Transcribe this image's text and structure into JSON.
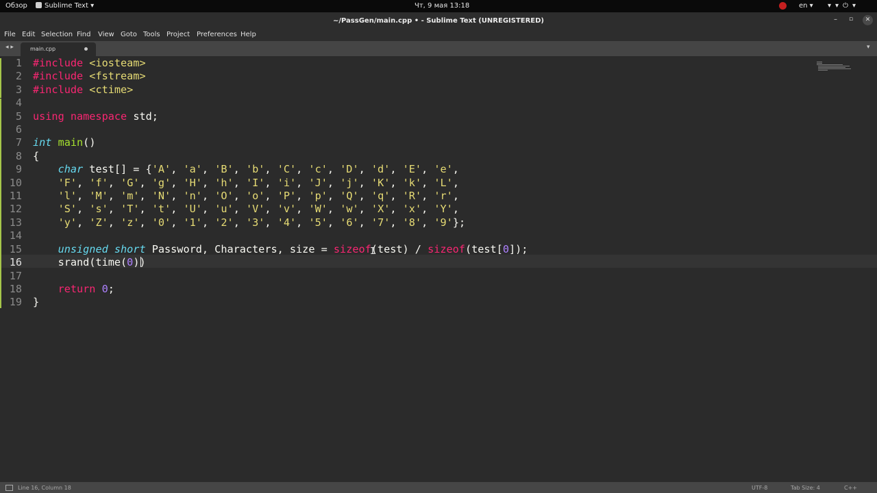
{
  "topbar": {
    "overview": "Обзор",
    "app_menu": "Sublime Text ▾",
    "clock": "Чт, 9 мая  13:18",
    "lang": "en ▾",
    "sys_icons": "▾▾⏻▾"
  },
  "window": {
    "title": "~/PassGen/main.cpp • - Sublime Text (UNREGISTERED)",
    "minimize": "–",
    "maximize": "▫",
    "close": "✕"
  },
  "menu": [
    "File",
    "Edit",
    "Selection",
    "Find",
    "View",
    "Goto",
    "Tools",
    "Project",
    "Preferences",
    "Help"
  ],
  "tabs": {
    "nav_arrows": "◂ ▸",
    "active_tab": "main.cpp",
    "dropdown": "▾"
  },
  "editor": {
    "current_line": 16,
    "line_numbers": [
      "1",
      "2",
      "3",
      "4",
      "5",
      "6",
      "7",
      "8",
      "9",
      "10",
      "11",
      "12",
      "13",
      "14",
      "15",
      "16",
      "17",
      "18",
      "19"
    ],
    "lines": [
      [
        [
          "pp",
          "#include "
        ],
        [
          "inc",
          "<iosteam>"
        ]
      ],
      [
        [
          "pp",
          "#include "
        ],
        [
          "inc",
          "<fstream>"
        ]
      ],
      [
        [
          "pp",
          "#include "
        ],
        [
          "inc",
          "<ctime>"
        ]
      ],
      [],
      [
        [
          "kw",
          "using namespace "
        ],
        [
          "pl",
          "std;"
        ]
      ],
      [],
      [
        [
          "type",
          "int"
        ],
        [
          "pl",
          " "
        ],
        [
          "fn",
          "main"
        ],
        [
          "pl",
          "()"
        ]
      ],
      [
        [
          "pl",
          "{"
        ]
      ],
      [
        [
          "pl",
          "    "
        ],
        [
          "type",
          "char"
        ],
        [
          "pl",
          " test[] = {"
        ],
        [
          "str",
          "'A'"
        ],
        [
          "pl",
          ", "
        ],
        [
          "str",
          "'a'"
        ],
        [
          "pl",
          ", "
        ],
        [
          "str",
          "'B'"
        ],
        [
          "pl",
          ", "
        ],
        [
          "str",
          "'b'"
        ],
        [
          "pl",
          ", "
        ],
        [
          "str",
          "'C'"
        ],
        [
          "pl",
          ", "
        ],
        [
          "str",
          "'c'"
        ],
        [
          "pl",
          ", "
        ],
        [
          "str",
          "'D'"
        ],
        [
          "pl",
          ", "
        ],
        [
          "str",
          "'d'"
        ],
        [
          "pl",
          ", "
        ],
        [
          "str",
          "'E'"
        ],
        [
          "pl",
          ", "
        ],
        [
          "str",
          "'e'"
        ],
        [
          "pl",
          ","
        ]
      ],
      [
        [
          "pl",
          "    "
        ],
        [
          "str",
          "'F'"
        ],
        [
          "pl",
          ", "
        ],
        [
          "str",
          "'f'"
        ],
        [
          "pl",
          ", "
        ],
        [
          "str",
          "'G'"
        ],
        [
          "pl",
          ", "
        ],
        [
          "str",
          "'g'"
        ],
        [
          "pl",
          ", "
        ],
        [
          "str",
          "'H'"
        ],
        [
          "pl",
          ", "
        ],
        [
          "str",
          "'h'"
        ],
        [
          "pl",
          ", "
        ],
        [
          "str",
          "'I'"
        ],
        [
          "pl",
          ", "
        ],
        [
          "str",
          "'i'"
        ],
        [
          "pl",
          ", "
        ],
        [
          "str",
          "'J'"
        ],
        [
          "pl",
          ", "
        ],
        [
          "str",
          "'j'"
        ],
        [
          "pl",
          ", "
        ],
        [
          "str",
          "'K'"
        ],
        [
          "pl",
          ", "
        ],
        [
          "str",
          "'k'"
        ],
        [
          "pl",
          ", "
        ],
        [
          "str",
          "'L'"
        ],
        [
          "pl",
          ","
        ]
      ],
      [
        [
          "pl",
          "    "
        ],
        [
          "str",
          "'l'"
        ],
        [
          "pl",
          ", "
        ],
        [
          "str",
          "'M'"
        ],
        [
          "pl",
          ", "
        ],
        [
          "str",
          "'m'"
        ],
        [
          "pl",
          ", "
        ],
        [
          "str",
          "'N'"
        ],
        [
          "pl",
          ", "
        ],
        [
          "str",
          "'n'"
        ],
        [
          "pl",
          ", "
        ],
        [
          "str",
          "'O'"
        ],
        [
          "pl",
          ", "
        ],
        [
          "str",
          "'o'"
        ],
        [
          "pl",
          ", "
        ],
        [
          "str",
          "'P'"
        ],
        [
          "pl",
          ", "
        ],
        [
          "str",
          "'p'"
        ],
        [
          "pl",
          ", "
        ],
        [
          "str",
          "'Q'"
        ],
        [
          "pl",
          ", "
        ],
        [
          "str",
          "'q'"
        ],
        [
          "pl",
          ", "
        ],
        [
          "str",
          "'R'"
        ],
        [
          "pl",
          ", "
        ],
        [
          "str",
          "'r'"
        ],
        [
          "pl",
          ","
        ]
      ],
      [
        [
          "pl",
          "    "
        ],
        [
          "str",
          "'S'"
        ],
        [
          "pl",
          ", "
        ],
        [
          "str",
          "'s'"
        ],
        [
          "pl",
          ", "
        ],
        [
          "str",
          "'T'"
        ],
        [
          "pl",
          ", "
        ],
        [
          "str",
          "'t'"
        ],
        [
          "pl",
          ", "
        ],
        [
          "str",
          "'U'"
        ],
        [
          "pl",
          ", "
        ],
        [
          "str",
          "'u'"
        ],
        [
          "pl",
          ", "
        ],
        [
          "str",
          "'V'"
        ],
        [
          "pl",
          ", "
        ],
        [
          "str",
          "'v'"
        ],
        [
          "pl",
          ", "
        ],
        [
          "str",
          "'W'"
        ],
        [
          "pl",
          ", "
        ],
        [
          "str",
          "'w'"
        ],
        [
          "pl",
          ", "
        ],
        [
          "str",
          "'X'"
        ],
        [
          "pl",
          ", "
        ],
        [
          "str",
          "'x'"
        ],
        [
          "pl",
          ", "
        ],
        [
          "str",
          "'Y'"
        ],
        [
          "pl",
          ","
        ]
      ],
      [
        [
          "pl",
          "    "
        ],
        [
          "str",
          "'y'"
        ],
        [
          "pl",
          ", "
        ],
        [
          "str",
          "'Z'"
        ],
        [
          "pl",
          ", "
        ],
        [
          "str",
          "'z'"
        ],
        [
          "pl",
          ", "
        ],
        [
          "str",
          "'0'"
        ],
        [
          "pl",
          ", "
        ],
        [
          "str",
          "'1'"
        ],
        [
          "pl",
          ", "
        ],
        [
          "str",
          "'2'"
        ],
        [
          "pl",
          ", "
        ],
        [
          "str",
          "'3'"
        ],
        [
          "pl",
          ", "
        ],
        [
          "str",
          "'4'"
        ],
        [
          "pl",
          ", "
        ],
        [
          "str",
          "'5'"
        ],
        [
          "pl",
          ", "
        ],
        [
          "str",
          "'6'"
        ],
        [
          "pl",
          ", "
        ],
        [
          "str",
          "'7'"
        ],
        [
          "pl",
          ", "
        ],
        [
          "str",
          "'8'"
        ],
        [
          "pl",
          ", "
        ],
        [
          "str",
          "'9'"
        ],
        [
          "pl",
          "};"
        ]
      ],
      [],
      [
        [
          "pl",
          "    "
        ],
        [
          "type",
          "unsigned short"
        ],
        [
          "pl",
          " Password, Characters, size = "
        ],
        [
          "bi",
          "sizeof"
        ],
        [
          "pl",
          "(test) / "
        ],
        [
          "bi",
          "sizeof"
        ],
        [
          "pl",
          "(test["
        ],
        [
          "num",
          "0"
        ],
        [
          "pl",
          "]);"
        ]
      ],
      [
        [
          "pl",
          "    srand(time("
        ],
        [
          "num",
          "0"
        ],
        [
          "pl",
          "))"
        ]
      ],
      [],
      [
        [
          "pl",
          "    "
        ],
        [
          "kw",
          "return"
        ],
        [
          "pl",
          " "
        ],
        [
          "num",
          "0"
        ],
        [
          "pl",
          ";"
        ]
      ],
      [
        [
          "pl",
          "}"
        ]
      ]
    ]
  },
  "status": {
    "position": "Line 16, Column 18",
    "encoding": "UTF-8",
    "tab_size": "Tab Size: 4",
    "syntax": "C++"
  },
  "colors": {
    "background": "#2b2b2b",
    "keyword": "#f92672",
    "type": "#66d9ef",
    "function": "#a6e22e",
    "string": "#e6db74",
    "number": "#ae81ff",
    "gutter_modified": "#a6c64a"
  }
}
